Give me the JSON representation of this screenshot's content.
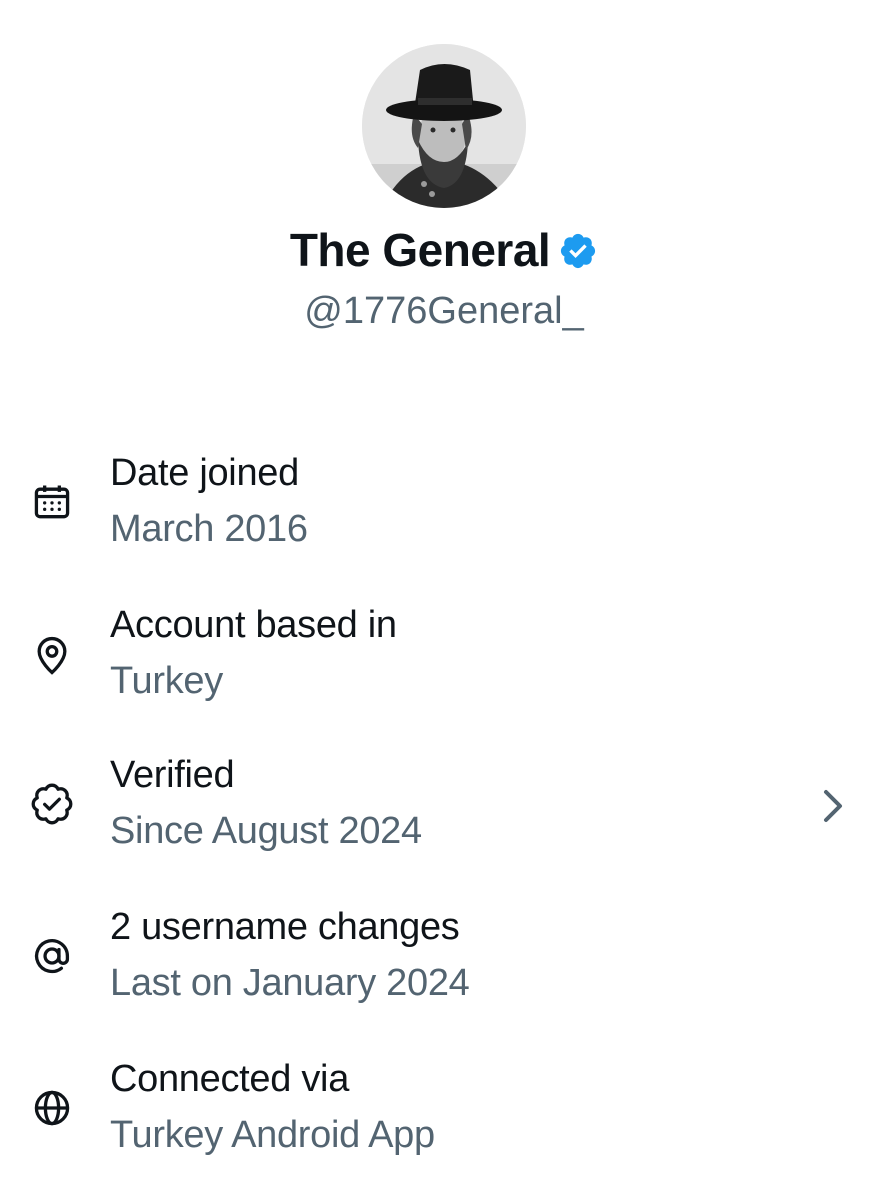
{
  "profile": {
    "display_name": "The General",
    "handle": "@1776General_",
    "verified": true,
    "verified_color": "#1d9bf0"
  },
  "info_items": [
    {
      "icon": "calendar-icon",
      "title": "Date joined",
      "subtitle": "March 2016",
      "has_chevron": false
    },
    {
      "icon": "location-pin-icon",
      "title": "Account based in",
      "subtitle": "Turkey",
      "has_chevron": false
    },
    {
      "icon": "verified-outline-icon",
      "title": "Verified",
      "subtitle": "Since August 2024",
      "has_chevron": true
    },
    {
      "icon": "at-sign-icon",
      "title": "2 username changes",
      "subtitle": "Last on January 2024",
      "has_chevron": false
    },
    {
      "icon": "globe-icon",
      "title": "Connected via",
      "subtitle": "Turkey Android App",
      "has_chevron": false
    }
  ],
  "colors": {
    "primary_text": "#0f1419",
    "secondary_text": "#536471",
    "background": "#ffffff"
  }
}
